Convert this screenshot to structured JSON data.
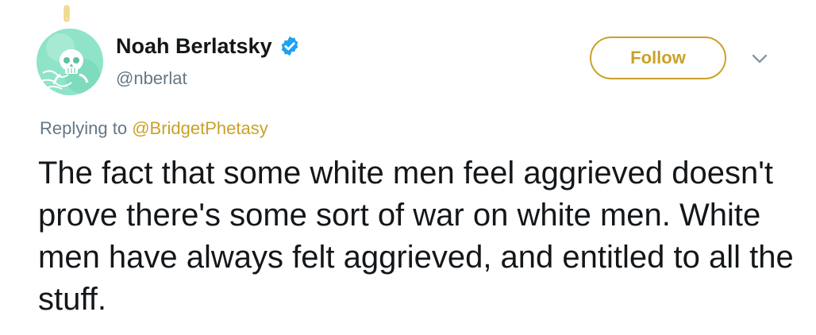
{
  "tweet": {
    "author": {
      "name": "Noah Berlatsky",
      "handle": "@nberlat",
      "verified_icon": "verified-badge-icon",
      "avatar_icon": "skull-avatar-icon"
    },
    "follow_label": "Follow",
    "more_icon": "chevron-down-icon",
    "pin_icon": "paperclip-icon",
    "replying_prefix": "Replying to",
    "replying_to": "@BridgetPhetasy",
    "text": "The fact that some white men feel aggrieved doesn't prove there's some sort of war on white men. White men have always felt aggrieved, and entitled to all the stuff."
  },
  "colors": {
    "accent": "#c9a129",
    "verified": "#1da1f2",
    "muted": "#657786",
    "text": "#14171a",
    "avatar_bg": "#8fe3c8"
  }
}
